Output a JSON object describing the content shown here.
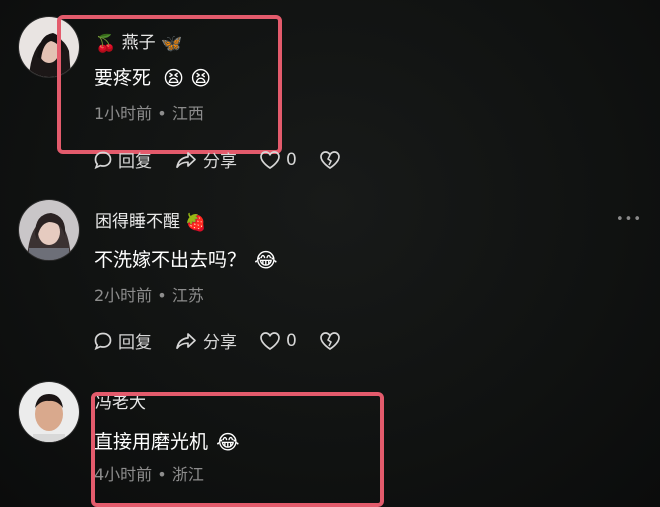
{
  "comments": [
    {
      "username": "燕子",
      "user_emoji_before": "🍒",
      "user_emoji_after": "🦋",
      "text": "要疼死",
      "text_emojis": "😫 😫",
      "time": "1小时前",
      "location": "江西",
      "reply_label": "回复",
      "share_label": "分享",
      "like_count": "0"
    },
    {
      "username": "困得睡不醒",
      "user_emoji_after": "🍓",
      "text": "不洗嫁不出去吗？",
      "text_emojis": "😂",
      "time": "2小时前",
      "location": "江苏",
      "reply_label": "回复",
      "share_label": "分享",
      "like_count": "0"
    },
    {
      "username": "冯老大",
      "text": "直接用磨光机",
      "text_emojis": "😂",
      "time": "4小时前",
      "location": "浙江"
    }
  ],
  "meta_separator": "•",
  "more_dots": "•••",
  "colors": {
    "background": "#0f1110",
    "highlight_box": "#e35b6c",
    "meta_text": "#8d8d8d"
  }
}
